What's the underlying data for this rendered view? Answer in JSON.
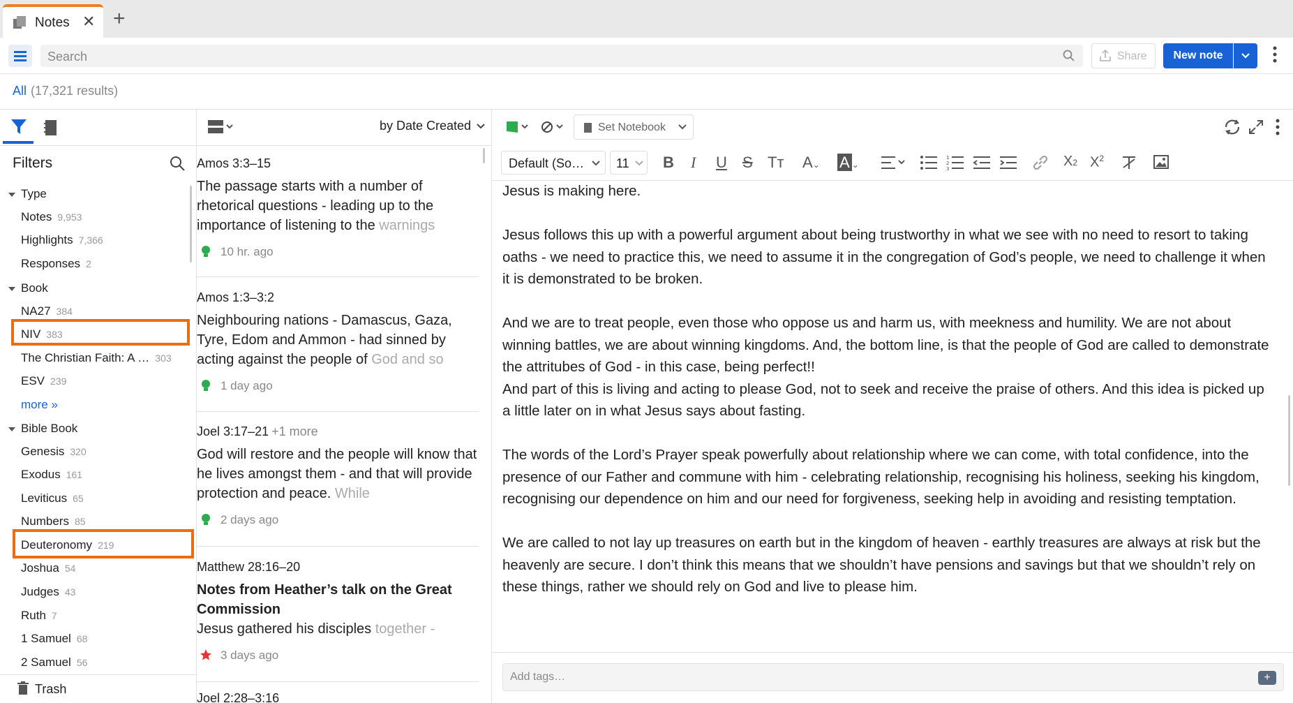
{
  "tab": {
    "label": "Notes",
    "close": "✕",
    "new": "+"
  },
  "toolbar": {
    "search_placeholder": "Search",
    "share_label": "Share",
    "new_note_label": "New note"
  },
  "results": {
    "scope": "All",
    "count": "(17,321 results)"
  },
  "filters": {
    "title": "Filters",
    "groups": [
      {
        "label": "Type"
      },
      {
        "label": "Book"
      },
      {
        "label": "Bible Book"
      }
    ],
    "type_items": [
      {
        "label": "Notes",
        "count": "9,953"
      },
      {
        "label": "Highlights",
        "count": "7,366"
      },
      {
        "label": "Responses",
        "count": "2"
      }
    ],
    "book_items": [
      {
        "label": "NA27",
        "count": "384"
      },
      {
        "label": "NIV",
        "count": "383"
      },
      {
        "label": "The Christian Faith: A …",
        "count": "303"
      },
      {
        "label": "ESV",
        "count": "239"
      }
    ],
    "more_label": "more »",
    "bible_book_items": [
      {
        "label": "Genesis",
        "count": "320"
      },
      {
        "label": "Exodus",
        "count": "161"
      },
      {
        "label": "Leviticus",
        "count": "65"
      },
      {
        "label": "Numbers",
        "count": "85"
      },
      {
        "label": "Deuteronomy",
        "count": "219"
      },
      {
        "label": "Joshua",
        "count": "54"
      },
      {
        "label": "Judges",
        "count": "43"
      },
      {
        "label": "Ruth",
        "count": "7"
      },
      {
        "label": "1 Samuel",
        "count": "68"
      },
      {
        "label": "2 Samuel",
        "count": "56"
      }
    ],
    "trash_label": "Trash"
  },
  "list": {
    "sort_label": "by Date Created",
    "notes": [
      {
        "ref": "Amos 3:3–15",
        "extra": "",
        "title": "",
        "body": "The passage starts with a number of rhetorical questions - leading up to the importance of listening to the ",
        "fade": "warnings",
        "time": "10 hr. ago",
        "icon": "bulb"
      },
      {
        "ref": "Amos 1:3–3:2",
        "extra": "",
        "title": "",
        "body": "Neighbouring nations - Damascus, Gaza, Tyre, Edom and Ammon - had sinned by acting against the people of ",
        "fade": "God and so",
        "time": "1 day ago",
        "icon": "bulb"
      },
      {
        "ref": "Joel 3:17–21",
        "extra": "+1 more",
        "title": "",
        "body": "God will restore and the people will know that he lives amongst them - and that will provide protection and peace. ",
        "fade": "While",
        "time": "2 days ago",
        "icon": "bulb"
      },
      {
        "ref": "Matthew 28:16–20",
        "extra": "",
        "title": "Notes from Heather’s talk on the Great Commission",
        "body": "Jesus gathered his disciples ",
        "fade": "together -",
        "time": "3 days ago",
        "icon": "star"
      },
      {
        "ref": "Joel 2:28–3:16",
        "extra": "",
        "title": "",
        "body": "",
        "fade": "",
        "time": "",
        "icon": ""
      }
    ]
  },
  "editor": {
    "set_notebook_label": "Set Notebook",
    "font_label": "Default (So…",
    "size_label": "11",
    "paragraphs": [
      "Jesus is making here.",
      "Jesus follows this up with a powerful argument about being trustworthy in what we see with no need to resort to taking oaths - we need to practice this, we need to assume it in the congregation of God’s people, we need to challenge it when it is demonstrated to be broken.",
      "And we are to treat people, even those who oppose us and harm us, with meekness and humility. We are not about winning battles, we are about winning kingdoms. And, the bottom line, is that the people of God are called to demonstrate the attritubes of God - in this case, being perfect!!",
      "And part of this is living and acting to please God, not to seek and receive the praise of others. And this idea is picked up a little later on in what Jesus says about fasting.",
      "The words of the Lord’s Prayer speak powerfully about relationship where we can come, with total confidence, into the presence of our Father and commune with him - celebrating relationship, recognising his holiness, seeking his kingdom, recognising our dependence on him and our need for forgiveness, seeking help in avoiding and resisting temptation.",
      "We are called to not lay up treasures on earth but in the kingdom of heaven - earthly treasures are always at risk but the heavenly are secure. I don’t think this means that we shouldn’t have pensions and savings but that we shouldn’t rely on these things, rather we should rely on God and live to please him."
    ],
    "tags_placeholder": "Add tags…"
  },
  "colors": {
    "accent": "#1763d6",
    "highlight_box": "#ec6c10",
    "tab_accent": "#f07d1f"
  }
}
